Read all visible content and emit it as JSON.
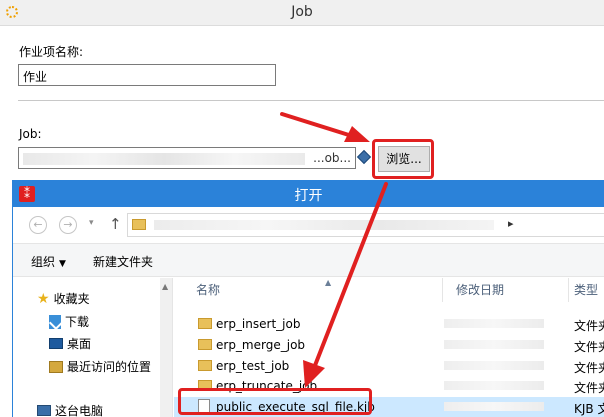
{
  "job_window": {
    "title": "Job",
    "name_label": "作业项名称:",
    "name_value": "作业",
    "job_label": "Job:",
    "job_path_tail": "...ob...",
    "browse_label": "浏览..."
  },
  "open_dialog": {
    "title": "打开",
    "app_icon_glyph": "⁑",
    "back_glyph": "←",
    "forward_glyph": "→",
    "history_glyph": "▾",
    "up_glyph": "↑",
    "address_chevron": "▸",
    "toolbar": {
      "organize": "组织",
      "organize_caret": "▼",
      "new_folder": "新建文件夹"
    },
    "nav": {
      "favorites": "收藏夹",
      "downloads": "下载",
      "desktop": "桌面",
      "recent": "最近访问的位置",
      "this_pc": "这台电脑"
    },
    "columns": {
      "name": "名称",
      "modified": "修改日期",
      "type": "类型"
    },
    "sort_glyph": "▲",
    "scroll_up_glyph": "▲",
    "files": [
      {
        "name": "erp_insert_job",
        "type": "文件夹"
      },
      {
        "name": "erp_merge_job",
        "type": "文件夹"
      },
      {
        "name": "erp_test_job",
        "type": "文件夹"
      },
      {
        "name": "erp_truncate_job",
        "type": "文件夹"
      },
      {
        "name": "public_execute_sql_file.kjb",
        "type": "KJB 文"
      }
    ]
  },
  "colors": {
    "accent_blue": "#2b82d9",
    "annotation_red": "#e02020",
    "selection": "#cce8ff"
  }
}
